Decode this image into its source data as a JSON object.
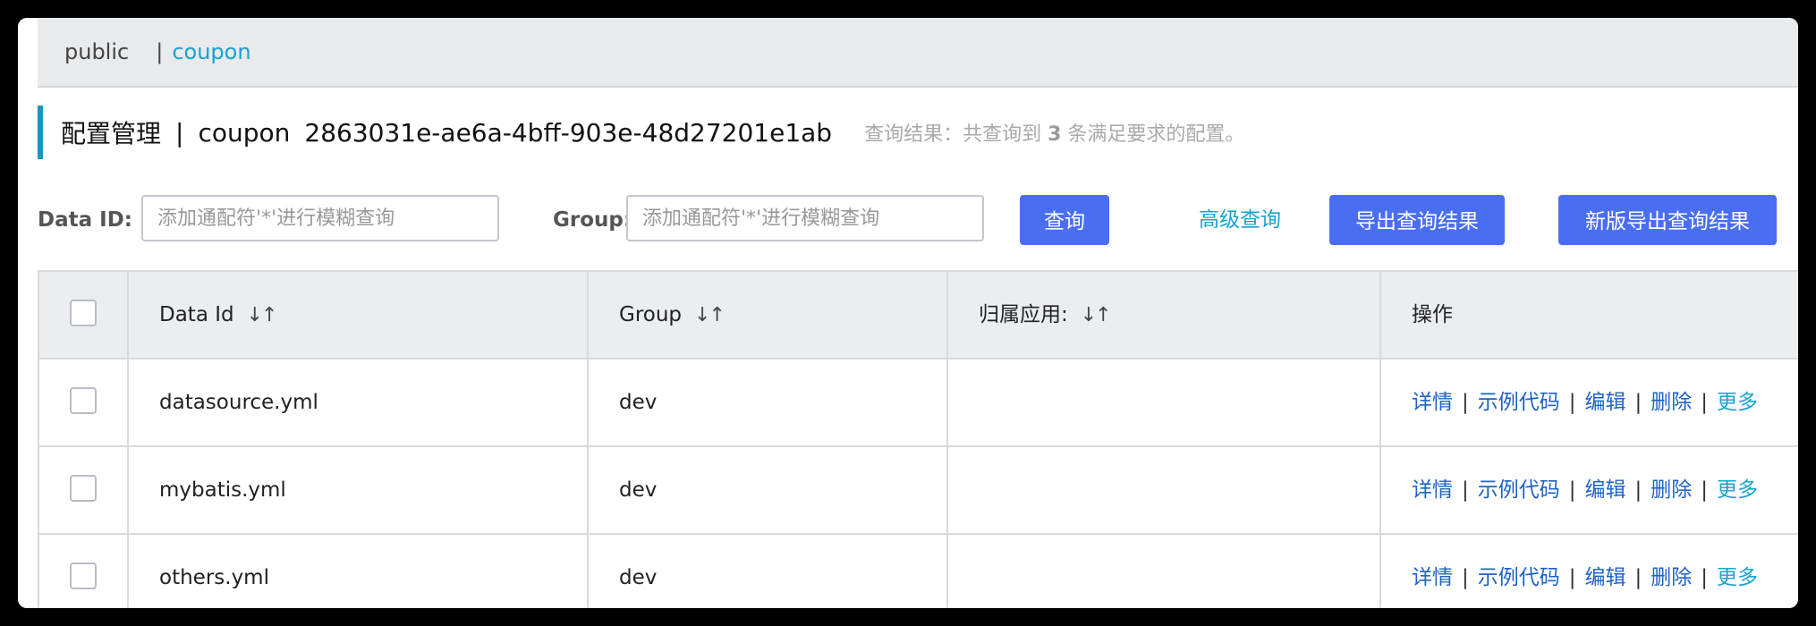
{
  "namespaces": {
    "items": [
      "public",
      "coupon"
    ],
    "separator": "|",
    "active": "coupon"
  },
  "title": {
    "main": "配置管理",
    "separator": "|",
    "namespace": "coupon",
    "namespace_id": "2863031e-ae6a-4bff-903e-48d27201e1ab",
    "result_prefix": "查询结果：共查询到",
    "result_count": "3",
    "result_suffix": "条满足要求的配置。"
  },
  "search": {
    "data_id_label": "Data ID:",
    "data_id_placeholder": "添加通配符'*'进行模糊查询",
    "group_label": "Group:",
    "group_placeholder": "添加通配符'*'进行模糊查询",
    "query_button": "查询",
    "advanced_query": "高级查询",
    "export_button": "导出查询结果",
    "new_export_button": "新版导出查询结果"
  },
  "table": {
    "headers": {
      "data_id": "Data Id",
      "group": "Group",
      "app": "归属应用:",
      "ops": "操作"
    },
    "sort_icon": "sort-icon",
    "rows": [
      {
        "data_id": "datasource.yml",
        "group": "dev",
        "app": ""
      },
      {
        "data_id": "mybatis.yml",
        "group": "dev",
        "app": ""
      },
      {
        "data_id": "others.yml",
        "group": "dev",
        "app": ""
      }
    ],
    "ops": {
      "detail": "详情",
      "sample": "示例代码",
      "edit": "编辑",
      "delete": "删除",
      "more": "更多",
      "pipe": "|"
    }
  }
}
